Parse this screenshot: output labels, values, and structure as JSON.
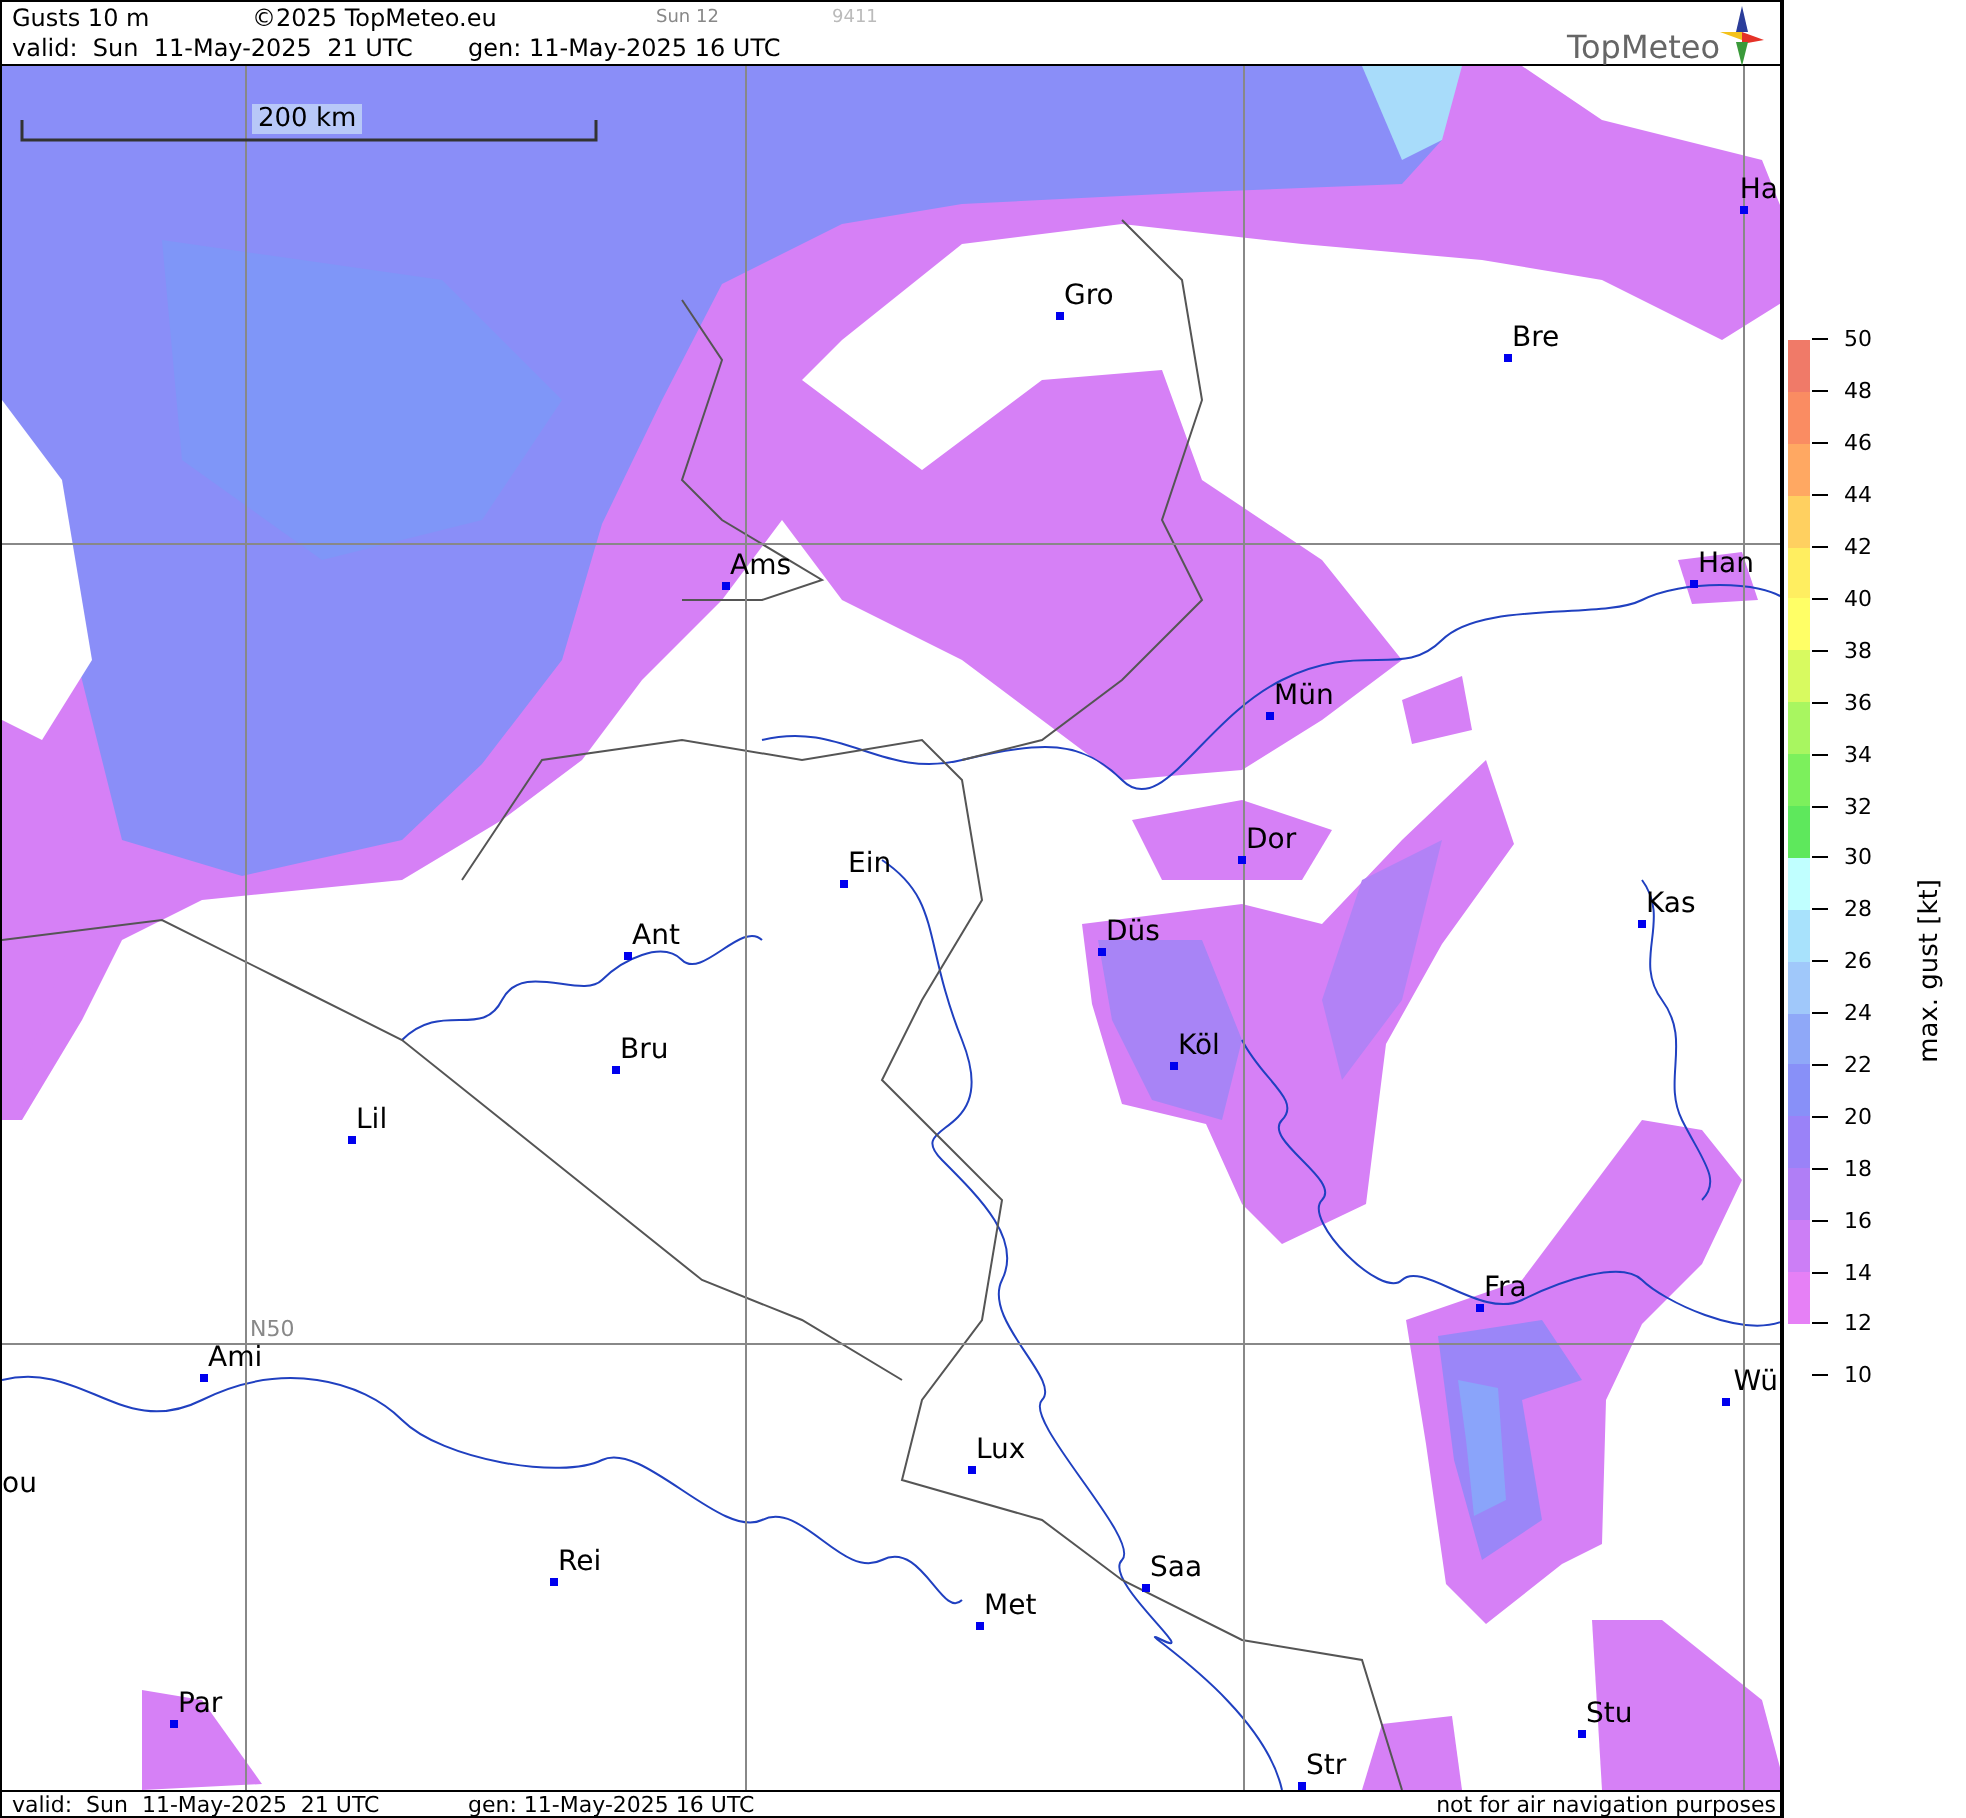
{
  "header": {
    "title": "Gusts 10 m",
    "copyright": "©2025 TopMeteo.eu",
    "day": "Sun 12",
    "code": "9411",
    "valid": "valid:  Sun  11-May-2025  21 UTC",
    "generated": "gen: 11-May-2025 16 UTC",
    "logo": "TopMeteo"
  },
  "map": {
    "scale_label": "200 km",
    "grid_label": "N50",
    "cities": [
      {
        "name": "Ha"
      },
      {
        "name": "Gro"
      },
      {
        "name": "Bre"
      },
      {
        "name": "Ams"
      },
      {
        "name": "Han"
      },
      {
        "name": "Mün"
      },
      {
        "name": "Dor"
      },
      {
        "name": "Ein"
      },
      {
        "name": "Kas"
      },
      {
        "name": "Düs"
      },
      {
        "name": "Ant"
      },
      {
        "name": "Köl"
      },
      {
        "name": "Bru"
      },
      {
        "name": "Lil"
      },
      {
        "name": "Fra"
      },
      {
        "name": "Ami"
      },
      {
        "name": "Wü"
      },
      {
        "name": "Lux"
      },
      {
        "name": "ou"
      },
      {
        "name": "Rei"
      },
      {
        "name": "Saa"
      },
      {
        "name": "Met"
      },
      {
        "name": "Par"
      },
      {
        "name": "Stu"
      },
      {
        "name": "Str"
      }
    ]
  },
  "legend": {
    "title": "max. gust [kt]",
    "ticks": [
      "50",
      "48",
      "46",
      "44",
      "42",
      "40",
      "38",
      "36",
      "34",
      "32",
      "30",
      "28",
      "26",
      "24",
      "22",
      "20",
      "18",
      "16",
      "14",
      "12",
      "10"
    ],
    "bins": [
      {
        "color": "#f07a68"
      },
      {
        "color": "#fa8c62"
      },
      {
        "color": "#ffa862"
      },
      {
        "color": "#ffd060"
      },
      {
        "color": "#ffee60"
      },
      {
        "color": "#ffff66"
      },
      {
        "color": "#d8fa60"
      },
      {
        "color": "#a8f660"
      },
      {
        "color": "#7cf05c"
      },
      {
        "color": "#5ee85c"
      },
      {
        "color": "#c0ffff"
      },
      {
        "color": "#a8e2fc"
      },
      {
        "color": "#a0c8fa"
      },
      {
        "color": "#8fa8f8"
      },
      {
        "color": "#8890f8"
      },
      {
        "color": "#9a82f8"
      },
      {
        "color": "#b07ef6"
      },
      {
        "color": "#cc7ef6"
      },
      {
        "color": "#e680f6"
      }
    ]
  },
  "footer": {
    "valid": "valid:  Sun  11-May-2025  21 UTC",
    "generated": "gen: 11-May-2025 16 UTC",
    "disclaimer": "not for air navigation purposes"
  }
}
